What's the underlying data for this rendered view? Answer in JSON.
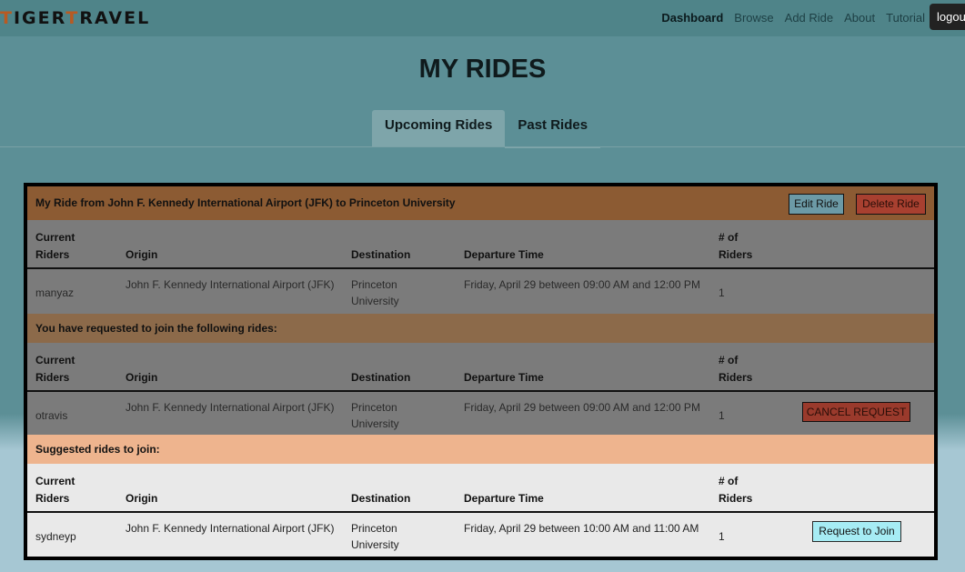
{
  "nav": {
    "brand_prefix": "T",
    "brand_i": "IGER",
    "brand_t": "T",
    "brand_rest": "RAVEL",
    "links": [
      "Dashboard",
      "Browse",
      "Add Ride",
      "About",
      "Tutorial"
    ],
    "active": "Dashboard",
    "logout": "logout"
  },
  "page": {
    "title": "MY RIDES",
    "tabs": [
      "Upcoming Rides",
      "Past Rides"
    ]
  },
  "columns": {
    "riders": "Current\nRiders",
    "origin": "Origin",
    "destination": "Destination",
    "departure": "Departure Time",
    "num": "# of\nRiders"
  },
  "my_ride": {
    "header": "My Ride from John F. Kennedy International Airport (JFK) to Princeton University",
    "edit": "Edit Ride",
    "delete": "Delete Ride",
    "row": {
      "rider": "manyaz",
      "origin": "John F. Kennedy International Airport (JFK)",
      "destination": "Princeton University",
      "departure": "Friday, April 29 between 09:00 AM and 12:00 PM",
      "num": "1"
    }
  },
  "requested": {
    "header": "You have requested to join the following rides:",
    "cancel": "CANCEL REQUEST",
    "row": {
      "rider": "otravis",
      "origin": "John F. Kennedy International Airport (JFK)",
      "destination": "Princeton University",
      "departure": "Friday, April 29 between 09:00 AM and 12:00 PM",
      "num": "1"
    }
  },
  "suggested": {
    "header": "Suggested rides to join:",
    "join": "Request to Join",
    "row": {
      "rider": "sydneyp",
      "origin": "John F. Kennedy International Airport (JFK)",
      "destination": "Princeton University",
      "departure": "Friday, April 29 between 10:00 AM and 11:00 AM",
      "num": "1"
    }
  },
  "colors": {
    "navbar": "#4f8489",
    "my_ride_header": "#8c5b33",
    "suggested_header": "#eeb48e",
    "join_button": "#a6ecf4",
    "delete_button": "#a84030"
  }
}
